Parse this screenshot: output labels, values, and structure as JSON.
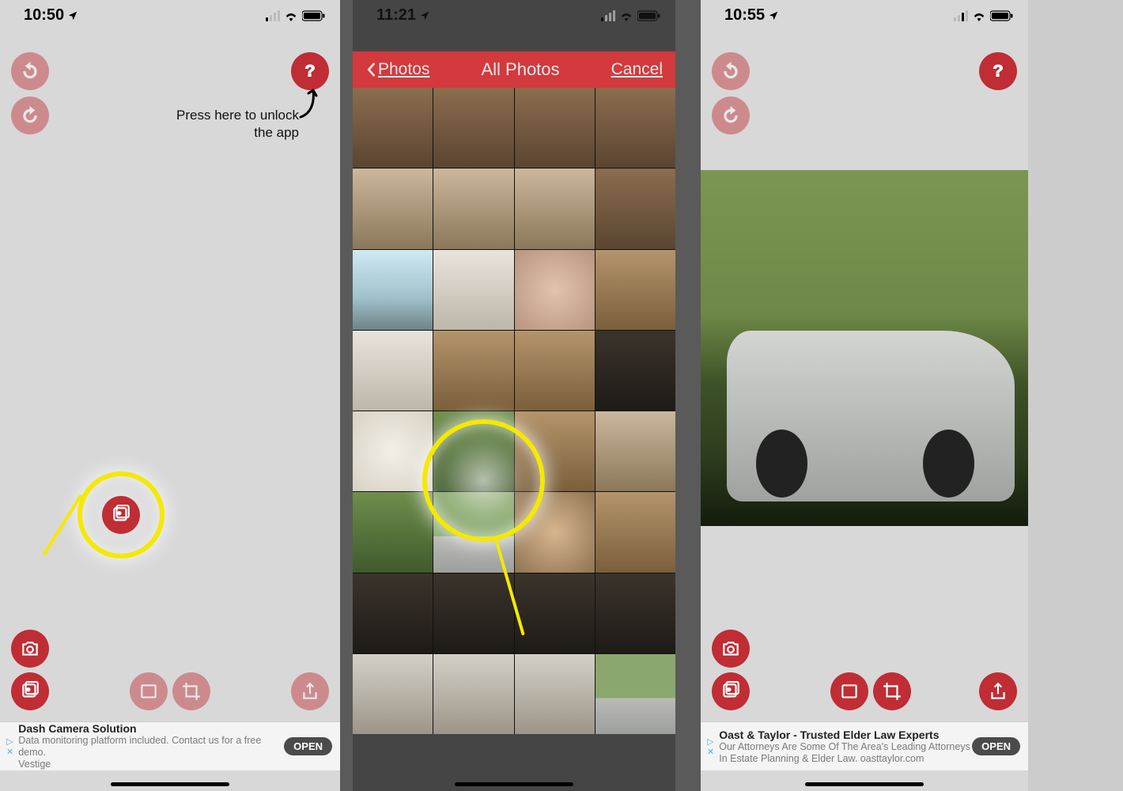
{
  "screens": {
    "s1": {
      "time": "10:50",
      "hint_line1": "Press here to unlock",
      "hint_line2": "the app",
      "ad": {
        "title": "Dash Camera Solution",
        "body": "Data monitoring platform included. Contact us for a free demo.",
        "source": "Vestige",
        "cta": "OPEN"
      }
    },
    "s2": {
      "time": "11:21",
      "nav_back": "Photos",
      "nav_title": "All Photos",
      "nav_cancel": "Cancel"
    },
    "s3": {
      "time": "10:55",
      "ad": {
        "title": "Oast & Taylor - Trusted Elder Law Experts",
        "body": "Our Attorneys Are Some Of The Area's Leading Attorneys In Estate Planning & Elder Law. oasttaylor.com",
        "cta": "OPEN"
      }
    }
  },
  "colors": {
    "accent": "#c02d34",
    "highlight": "#f5e900"
  }
}
